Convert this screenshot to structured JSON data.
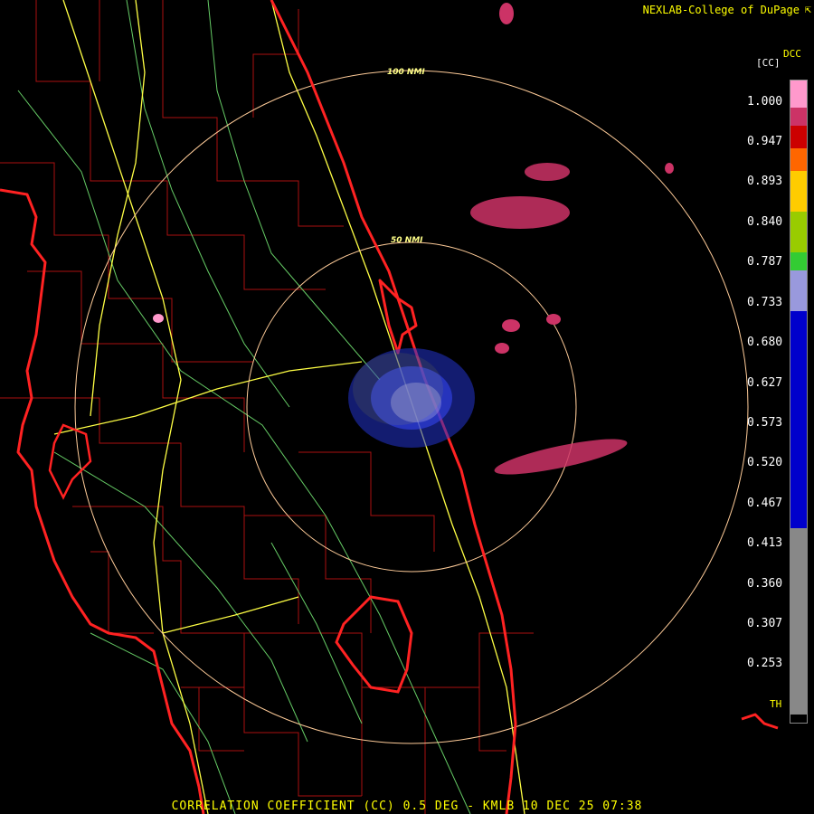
{
  "header": {
    "credit": "NEXLAB-College of DuPage",
    "credit_icon": "corner-arrow-icon"
  },
  "footer": {
    "title": "CORRELATION COEFFICIENT (CC) 0.5 DEG - KMLB 10 DEC 25 07:38"
  },
  "rings": [
    {
      "label": "100 NMI"
    },
    {
      "label": "50 NMI"
    }
  ],
  "legend": {
    "product": "DCC",
    "unit": "[CC]",
    "ticks": [
      "1.000",
      "0.947",
      "0.893",
      "0.840",
      "0.787",
      "0.733",
      "0.680",
      "0.627",
      "0.573",
      "0.520",
      "0.467",
      "0.413",
      "0.360",
      "0.307",
      "0.253"
    ],
    "threshold_label": "TH",
    "colors": {
      "pink": "#ff99cc",
      "magenta": "#cc3366",
      "red": "#cc0000",
      "orange": "#ff6600",
      "yellow": "#ffff00",
      "green": "#33cc33",
      "lavender": "#9999dd",
      "blue": "#0000cc",
      "gray": "#888888",
      "black": "#000000"
    }
  },
  "colors": {
    "state_border": "#ff2222",
    "county": "#aa1111",
    "highway": "#ffff44",
    "road": "#66cc66",
    "range_ring": "#ffcc99"
  }
}
